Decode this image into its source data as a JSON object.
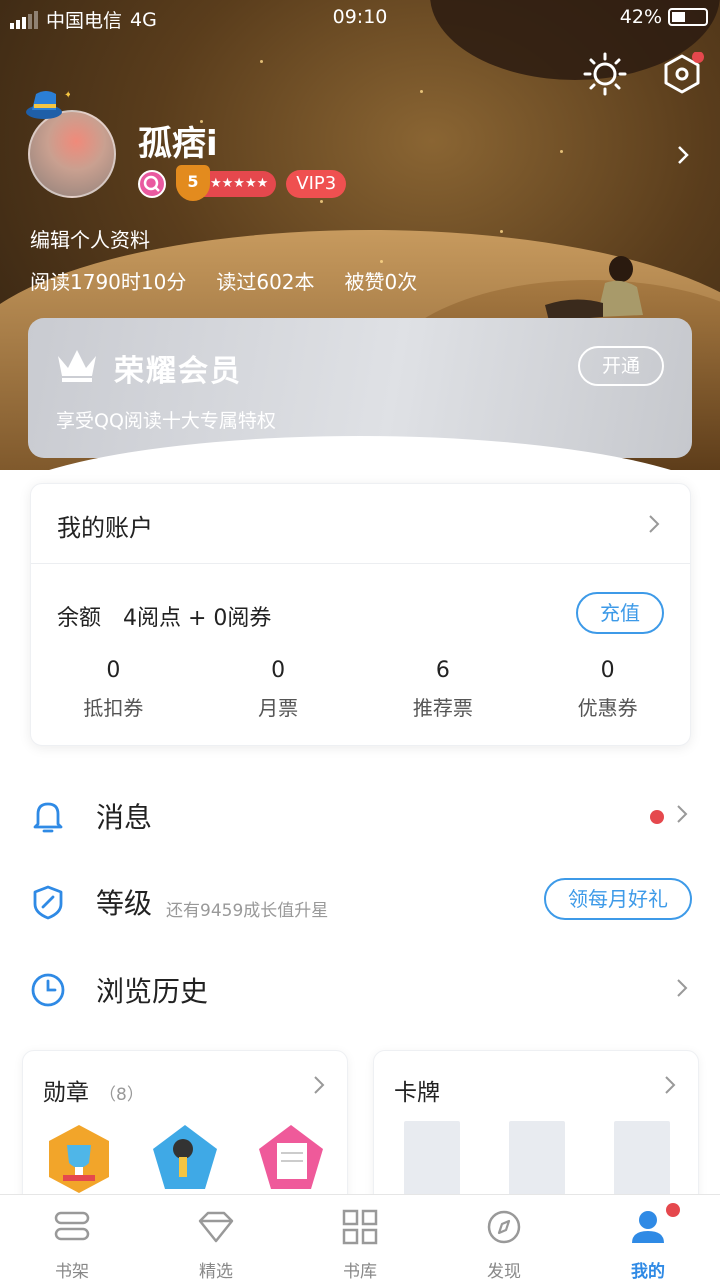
{
  "status": {
    "carrier": "中国电信",
    "network": "4G",
    "time": "09:10",
    "battery": "42%",
    "battery_level": 0.42
  },
  "profile": {
    "name": "孤痞i",
    "level_number": "5",
    "vip": "VIP3",
    "edit": "编辑个人资料",
    "stats": [
      "阅读1790时10分",
      "读过602本",
      "被赞0次"
    ]
  },
  "vipcard": {
    "title": "荣耀会员",
    "subtitle": "享受QQ阅读十大专属特权",
    "button": "开通"
  },
  "account": {
    "title": "我的账户",
    "balance_label": "余额",
    "balance_value": "4阅点 + 0阅券",
    "recharge": "充值",
    "items": [
      {
        "value": "0",
        "label": "抵扣券"
      },
      {
        "value": "0",
        "label": "月票"
      },
      {
        "value": "6",
        "label": "推荐票"
      },
      {
        "value": "0",
        "label": "优惠券"
      }
    ]
  },
  "menu": {
    "messages": "消息",
    "level": "等级",
    "level_hint": "还有9459成长值升星",
    "level_button": "领每月好礼",
    "history": "浏览历史"
  },
  "medals": {
    "title": "勋章",
    "count": "（8）"
  },
  "cards": {
    "title": "卡牌"
  },
  "tabs": [
    {
      "label": "书架",
      "icon": "bookshelf-icon"
    },
    {
      "label": "精选",
      "icon": "diamond-icon"
    },
    {
      "label": "书库",
      "icon": "grid-icon"
    },
    {
      "label": "发现",
      "icon": "compass-icon"
    },
    {
      "label": "我的",
      "icon": "person-icon"
    }
  ],
  "colors": {
    "accent": "#2f8ae5",
    "alert": "#e5484d"
  }
}
